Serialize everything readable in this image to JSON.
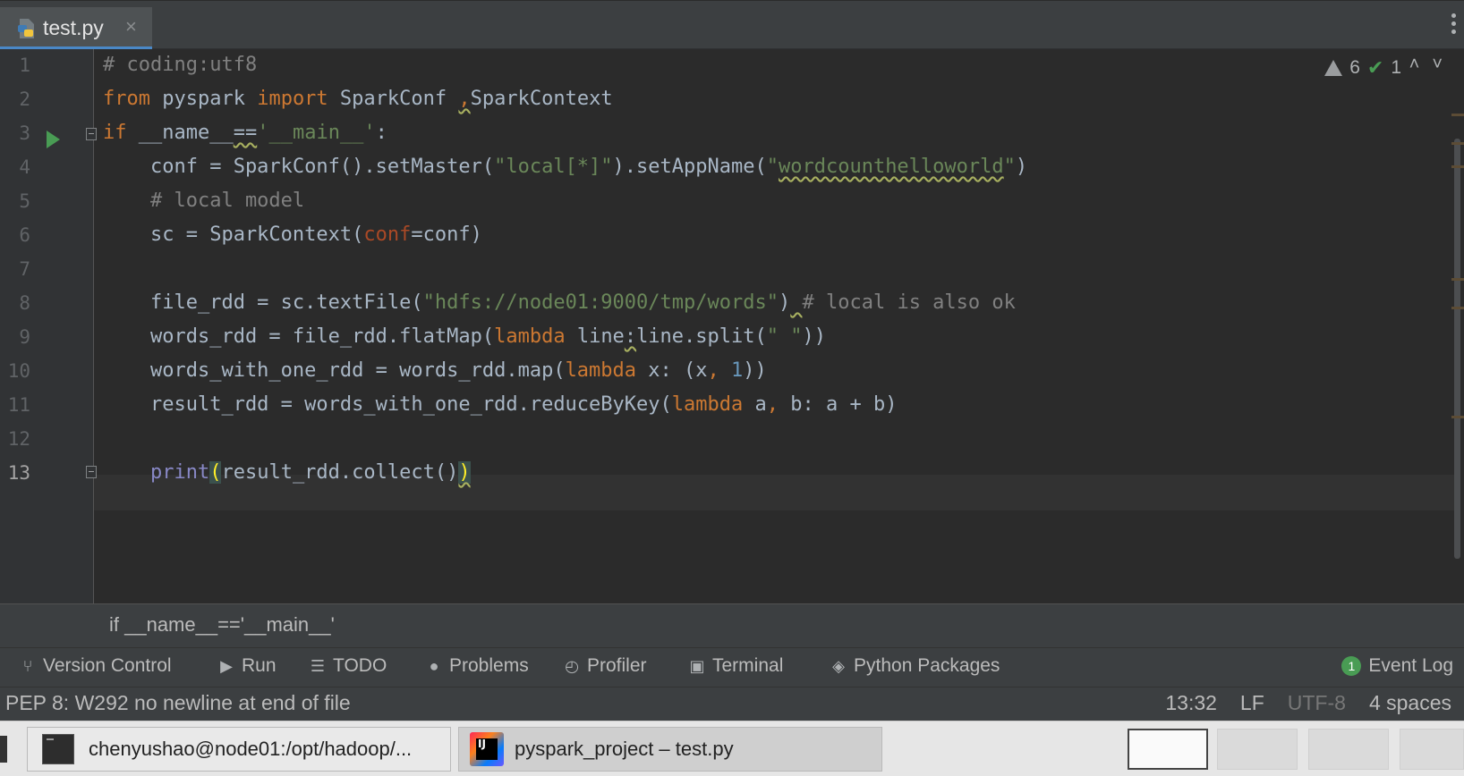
{
  "tab": {
    "label": "test.py",
    "close": "×"
  },
  "gutter": {
    "line_numbers": [
      "1",
      "2",
      "3",
      "4",
      "5",
      "6",
      "7",
      "8",
      "9",
      "10",
      "11",
      "12",
      "13"
    ]
  },
  "inspections": {
    "warnings": "6",
    "checks": "1"
  },
  "code": {
    "l1": "# coding:utf8",
    "l2_from": "from",
    "l2_mod": " pyspark ",
    "l2_import": "import",
    "l2_a": " SparkConf ",
    "l2_comma": ",",
    "l2_b": "SparkContext",
    "l3_if": "if",
    "l3_a": " __name__",
    "l3_eq": "==",
    "l3_str": "'__main__'",
    "l3_colon": ":",
    "l4_a": "    conf = SparkConf().setMaster(",
    "l4_s1": "\"local[*]\"",
    "l4_b": ").setAppName(",
    "l4_q1": "\"",
    "l4_s2": "wordcounthelloworld",
    "l4_q2": "\"",
    "l4_c": ")",
    "l5": "    # local model",
    "l6_a": "    sc = SparkContext(",
    "l6_p": "conf",
    "l6_b": "=conf)",
    "l8_a": "    file_rdd = sc.textFile(",
    "l8_s": "\"hdfs://node01:9000/tmp/words\"",
    "l8_b": ")",
    "l8_sp": " ",
    "l8_c": "# local is also ok",
    "l9_a": "    words_rdd = file_rdd.flatMap(",
    "l9_kw": "lambda",
    "l9_b": " line",
    "l9_colon": ":",
    "l9_c": "line.split(",
    "l9_s": "\" \"",
    "l9_d": "))",
    "l10_a": "    words_with_one_rdd = words_rdd.map(",
    "l10_kw": "lambda",
    "l10_b": " x: (x",
    "l10_comma": ",",
    "l10_sp": " ",
    "l10_n": "1",
    "l10_c": "))",
    "l11_a": "    result_rdd = words_with_one_rdd.reduceByKey(",
    "l11_kw": "lambda",
    "l11_b": " a",
    "l11_comma": ",",
    "l11_c": " b: a + b)",
    "l13_indent": "    ",
    "l13_print": "print",
    "l13_open": "(",
    "l13_a": "result_rdd.collect()",
    "l13_close": ")"
  },
  "breadcrumb": "if __name__=='__main__'",
  "tool_windows": [
    {
      "label": "Version Control",
      "icon": "branch-icon"
    },
    {
      "label": "Run",
      "icon": "play-icon"
    },
    {
      "label": "TODO",
      "icon": "list-icon"
    },
    {
      "label": "Problems",
      "icon": "info-icon"
    },
    {
      "label": "Profiler",
      "icon": "profiler-icon"
    },
    {
      "label": "Terminal",
      "icon": "terminal-icon"
    },
    {
      "label": "Python Packages",
      "icon": "layers-icon"
    }
  ],
  "event_log": {
    "label": "Event Log",
    "count": "1"
  },
  "status": {
    "message": "PEP 8: W292 no newline at end of file",
    "position": "13:32",
    "line_sep": "LF",
    "encoding": "UTF-8",
    "indent": "4 spaces"
  },
  "taskbar": {
    "terminal_task": "chenyushao@node01:/opt/hadoop/...",
    "ide_task": "pyspark_project – test.py"
  },
  "colors": {
    "keyword": "#cc7832",
    "string": "#6a8759",
    "comment": "#808080",
    "number": "#6897bb",
    "tab_accent": "#4a88c7"
  }
}
